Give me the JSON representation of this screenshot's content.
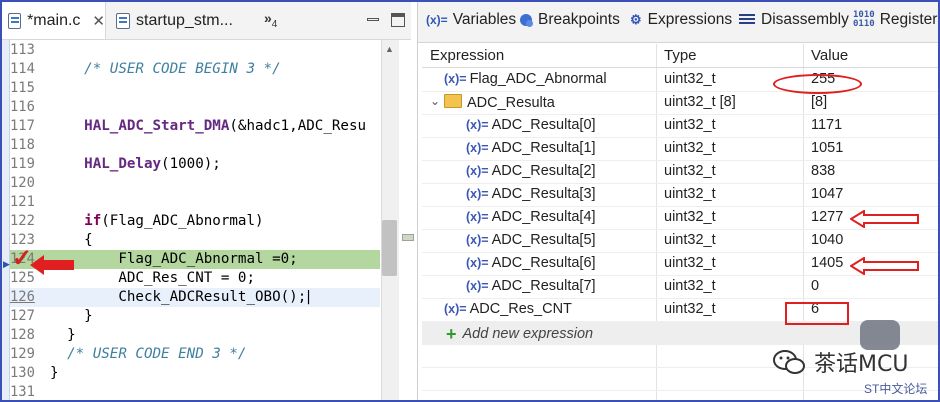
{
  "editor": {
    "tabs": [
      {
        "label": "*main.c",
        "close": "✕"
      },
      {
        "label": "startup_stm..."
      }
    ],
    "overflow": "»",
    "overflow_count": "4",
    "lines": [
      {
        "num": "113",
        "parts": []
      },
      {
        "num": "114",
        "parts": [
          {
            "t": "    "
          },
          {
            "t": "/* USER CODE BEGIN 3 */",
            "c": "comment"
          }
        ]
      },
      {
        "num": "115",
        "parts": []
      },
      {
        "num": "116",
        "parts": []
      },
      {
        "num": "117",
        "parts": [
          {
            "t": "    "
          },
          {
            "t": "HAL_ADC_Start_DMA",
            "c": "fn"
          },
          {
            "t": "(&hadc1,ADC_Resu"
          }
        ]
      },
      {
        "num": "118",
        "parts": []
      },
      {
        "num": "119",
        "parts": [
          {
            "t": "    "
          },
          {
            "t": "HAL_Delay",
            "c": "fn"
          },
          {
            "t": "(1000);"
          }
        ]
      },
      {
        "num": "120",
        "parts": []
      },
      {
        "num": "121",
        "parts": []
      },
      {
        "num": "122",
        "parts": [
          {
            "t": "    "
          },
          {
            "t": "if",
            "c": "kw"
          },
          {
            "t": "(Flag_ADC_Abnormal)"
          }
        ]
      },
      {
        "num": "123",
        "parts": [
          {
            "t": "    {"
          }
        ]
      },
      {
        "num": "124",
        "parts": [
          {
            "t": "        Flag_ADC_Abnormal =0;"
          }
        ],
        "hl": "green"
      },
      {
        "num": "125",
        "parts": [
          {
            "t": "        ADC_Res_CNT = 0;"
          }
        ]
      },
      {
        "num": "126",
        "parts": [
          {
            "t": "        Check_ADCResult_OBO();"
          }
        ],
        "hl": "blue",
        "cur": true
      },
      {
        "num": "127",
        "parts": [
          {
            "t": "    }"
          }
        ]
      },
      {
        "num": "128",
        "parts": [
          {
            "t": "  }"
          }
        ]
      },
      {
        "num": "129",
        "parts": [
          {
            "t": "  "
          },
          {
            "t": "/* USER CODE END 3 */",
            "c": "comment"
          }
        ]
      },
      {
        "num": "130",
        "parts": [
          {
            "t": "}"
          }
        ]
      },
      {
        "num": "131",
        "parts": []
      }
    ]
  },
  "debug": {
    "tabs": [
      {
        "label": "Variables",
        "icon": "(x)="
      },
      {
        "label": "Breakpoints"
      },
      {
        "label": "Expressions"
      },
      {
        "label": "Disassembly"
      },
      {
        "label": "Registers"
      }
    ],
    "registers_icon_text": "1010\n0110",
    "columns": [
      "Expression",
      "Type",
      "Value"
    ],
    "rows": [
      {
        "expr": "Flag_ADC_Abnormal",
        "type": "uint32_t",
        "value": "255",
        "level": 0,
        "kind": "var"
      },
      {
        "expr": "ADC_Resulta",
        "type": "uint32_t [8]",
        "value": "[8]",
        "level": 0,
        "kind": "array",
        "expand": "⌄"
      },
      {
        "expr": "ADC_Resulta[0]",
        "type": "uint32_t",
        "value": "1171",
        "level": 1,
        "kind": "var"
      },
      {
        "expr": "ADC_Resulta[1]",
        "type": "uint32_t",
        "value": "1051",
        "level": 1,
        "kind": "var"
      },
      {
        "expr": "ADC_Resulta[2]",
        "type": "uint32_t",
        "value": "838",
        "level": 1,
        "kind": "var"
      },
      {
        "expr": "ADC_Resulta[3]",
        "type": "uint32_t",
        "value": "1047",
        "level": 1,
        "kind": "var"
      },
      {
        "expr": "ADC_Resulta[4]",
        "type": "uint32_t",
        "value": "1277",
        "level": 1,
        "kind": "var"
      },
      {
        "expr": "ADC_Resulta[5]",
        "type": "uint32_t",
        "value": "1040",
        "level": 1,
        "kind": "var"
      },
      {
        "expr": "ADC_Resulta[6]",
        "type": "uint32_t",
        "value": "1405",
        "level": 1,
        "kind": "var"
      },
      {
        "expr": "ADC_Resulta[7]",
        "type": "uint32_t",
        "value": "0",
        "level": 1,
        "kind": "var"
      },
      {
        "expr": "ADC_Res_CNT",
        "type": "uint32_t",
        "value": "6",
        "level": 0,
        "kind": "var"
      }
    ],
    "add_expression": "Add new expression",
    "var_icon": "(x)="
  },
  "watermark": {
    "name": "茶话MCU",
    "forum": "ST中文论坛"
  },
  "colors": {
    "annotation": "#e02020",
    "frame": "#3b4fb8",
    "current_line": "#b4d7a0"
  }
}
